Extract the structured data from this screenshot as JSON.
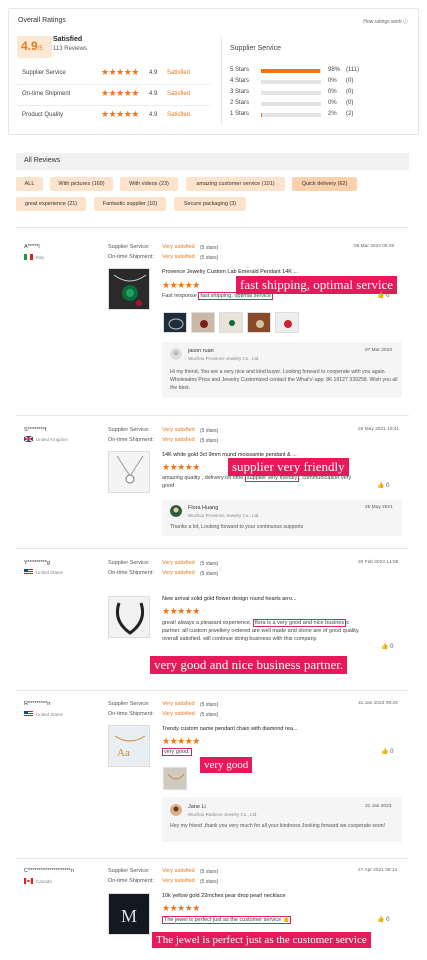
{
  "overall": {
    "title": "Overall Ratings",
    "how_link": "How ratings work",
    "score": "4.9",
    "score_suffix": "/5",
    "satisfaction": "Satisfied",
    "reviews_count": "113 Reviews",
    "metrics": [
      {
        "label": "Supplier Service",
        "score": "4.9",
        "status": "Satisfied"
      },
      {
        "label": "On-time Shipment",
        "score": "4.9",
        "status": "Satisfied"
      },
      {
        "label": "Product Quality",
        "score": "4.9",
        "status": "Satisfied"
      }
    ],
    "supplier_service": {
      "title": "Supplier Service",
      "rows": [
        {
          "label": "5 Stars",
          "percent": "98%",
          "count": "(111)",
          "fill": 0.98
        },
        {
          "label": "4 Stars",
          "percent": "0%",
          "count": "(0)",
          "fill": 0
        },
        {
          "label": "3 Stars",
          "percent": "0%",
          "count": "(0)",
          "fill": 0
        },
        {
          "label": "2 Stars",
          "percent": "0%",
          "count": "(0)",
          "fill": 0
        },
        {
          "label": "1 Stars",
          "percent": "2%",
          "count": "(2)",
          "fill": 0.02
        }
      ]
    }
  },
  "all_reviews": {
    "title": "All Reviews",
    "filters": [
      "ALL",
      "With pictures (169)",
      "With videos (23)",
      "amazing customer service (101)",
      "Quick delivery (62)",
      "great experience (21)",
      "Fantastic supplier (10)",
      "Secure packaging (3)"
    ]
  },
  "labels": {
    "supplier_service": "Supplier Service:",
    "ontime_shipment": "On-time Shipment:",
    "very_satisfied": "Very satisfied",
    "five_stars": "(5 stars)"
  },
  "reviews": [
    {
      "user": "A*****l",
      "country": "Italy",
      "date": "05 Mar 2023 05:30",
      "product": "Provence Jewelry Custom Lab Emerald Pendant 14K ...",
      "text_prefix": "Fast response ",
      "text_highlight": "fast shipping, optimal service",
      "likes": "0",
      "callout": "fast shipping, optimal service",
      "reply": {
        "name": "jason ruan",
        "company": "Wuzhou Provence Jewelry Co., Ltd.",
        "date": "07 Mar 2023",
        "text": "Hi my friend, You are a very nice and kind buyer. Looking forward to cooperate with you again. Wholesales Price and Jewelry Customized contact the What's'-app: 86 19127 339258. Wish you all the best."
      }
    },
    {
      "user": "S********f",
      "country": "United Kingdom",
      "date": "25 May 2021 10:41",
      "product": "14K white gold 3ct 9mm round moissanite pendant & ...",
      "text_prefix": "amazing quality , delivery on time ",
      "text_highlight": "supplier very friendly",
      "text_suffix": ", communication very good",
      "likes": "0",
      "callout": "supplier very friendly",
      "reply": {
        "name": "Flora Huang",
        "company": "Wuzhou Provence Jewelry Co., Ltd.",
        "date": "25 May 2021",
        "text": "Thanks a lot, Looking forward to your continuous supports"
      }
    },
    {
      "user": "Y*********g",
      "country": "United States",
      "date": "20 Feb 2023 14:08",
      "product": "New arrival solid gold flower design round hearts arro...",
      "text_prefix": "great! always a pleasant experience. ",
      "text_highlight": "flora is a very good and nice busines",
      "text_suffix": "s partner. all custom jewellery ordered are well made and stone are of good quality. overall satisfied. will continue doing business with this company.",
      "likes": "0",
      "callout": "very good and nice business partner."
    },
    {
      "user": "R*********n",
      "country": "United States",
      "date": "31 Jan 2023 09:25",
      "product": "Trendy custom name pendant chain with diamond rea...",
      "text_highlight": "very good.",
      "likes": "0",
      "callout": "very good",
      "reply": {
        "name": "Jane Li",
        "company": "Wuzhou Redoors Jewelry Co., Ltd.",
        "date": "31 Jan 2023",
        "text": "Hey my friend ,thank you very much for all your kindness Jooking forward we cooperate soon!"
      }
    },
    {
      "user": "C********************n",
      "country": "Canada",
      "date": "27 Apr 2021 08:14",
      "product": "10k yellow gold 22mches pear drop pearl necklace",
      "text_highlight": "The jewel is perfect just as the customer service 👍",
      "likes": "0",
      "callout": "The jewel is perfect just as the customer service"
    }
  ]
}
